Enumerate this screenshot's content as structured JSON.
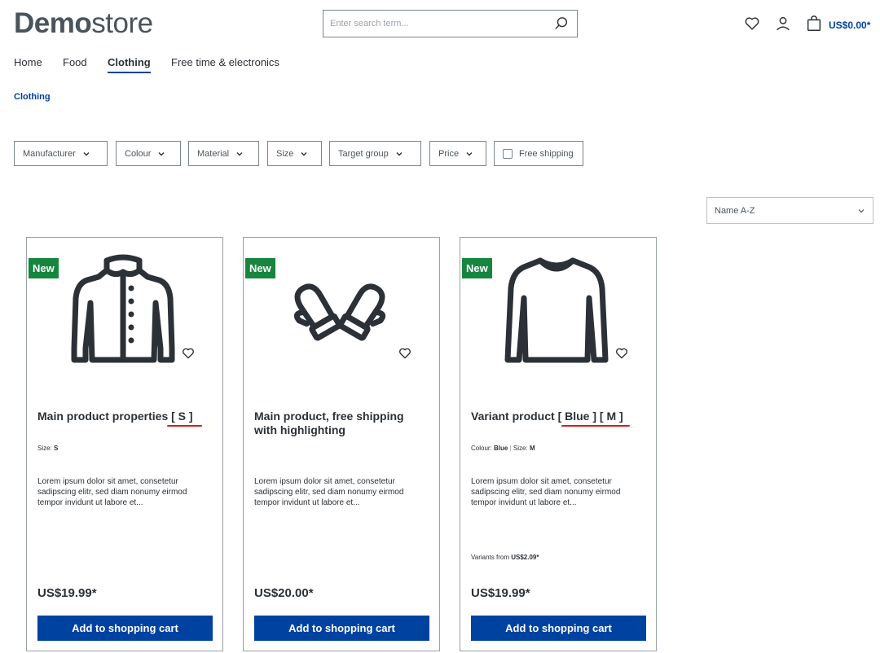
{
  "header": {
    "logo_bold": "Demo",
    "logo_light": "store",
    "search_placeholder": "Enter search term...",
    "cart_total": "US$0.00*"
  },
  "nav": {
    "items": [
      "Home",
      "Food",
      "Clothing",
      "Free time & electronics"
    ],
    "active": "Clothing"
  },
  "breadcrumb": "Clothing",
  "filters": [
    "Manufacturer",
    "Colour",
    "Material",
    "Size",
    "Target group",
    "Price"
  ],
  "free_shipping_label": "Free shipping",
  "sort": {
    "selected": "Name A-Z"
  },
  "colors": {
    "accent": "#0042a0",
    "badge": "#16863e",
    "highlight_underline": "#d11f1f"
  },
  "products": [
    {
      "badge": "New",
      "image_icon": "jacket-icon",
      "title": "Main product properties [ S ]",
      "props": [
        {
          "label": "Size:",
          "value": "S"
        }
      ],
      "description": "Lorem ipsum dolor sit amet, consetetur sadipscing elitr, sed diam nonumy eirmod tempor invidunt ut labore et...",
      "variants_label": "",
      "variants_price": "",
      "price": "US$19.99*",
      "button": "Add to shopping cart"
    },
    {
      "badge": "New",
      "image_icon": "mittens-icon",
      "title": "Main product, free shipping with highlighting",
      "props": [],
      "description": "Lorem ipsum dolor sit amet, consetetur sadipscing elitr, sed diam nonumy eirmod tempor invidunt ut labore et...",
      "variants_label": "",
      "variants_price": "",
      "price": "US$20.00*",
      "button": "Add to shopping cart"
    },
    {
      "badge": "New",
      "image_icon": "sweater-icon",
      "title": "Variant product [ Blue ] [ M ]",
      "props": [
        {
          "label": "Colour:",
          "value": "Blue"
        },
        {
          "label": "Size:",
          "value": "M"
        }
      ],
      "description": "Lorem ipsum dolor sit amet, consetetur sadipscing elitr, sed diam nonumy eirmod tempor invidunt ut labore et...",
      "variants_label": "Variants from",
      "variants_price": "US$2.09*",
      "price": "US$19.99*",
      "button": "Add to shopping cart"
    }
  ]
}
